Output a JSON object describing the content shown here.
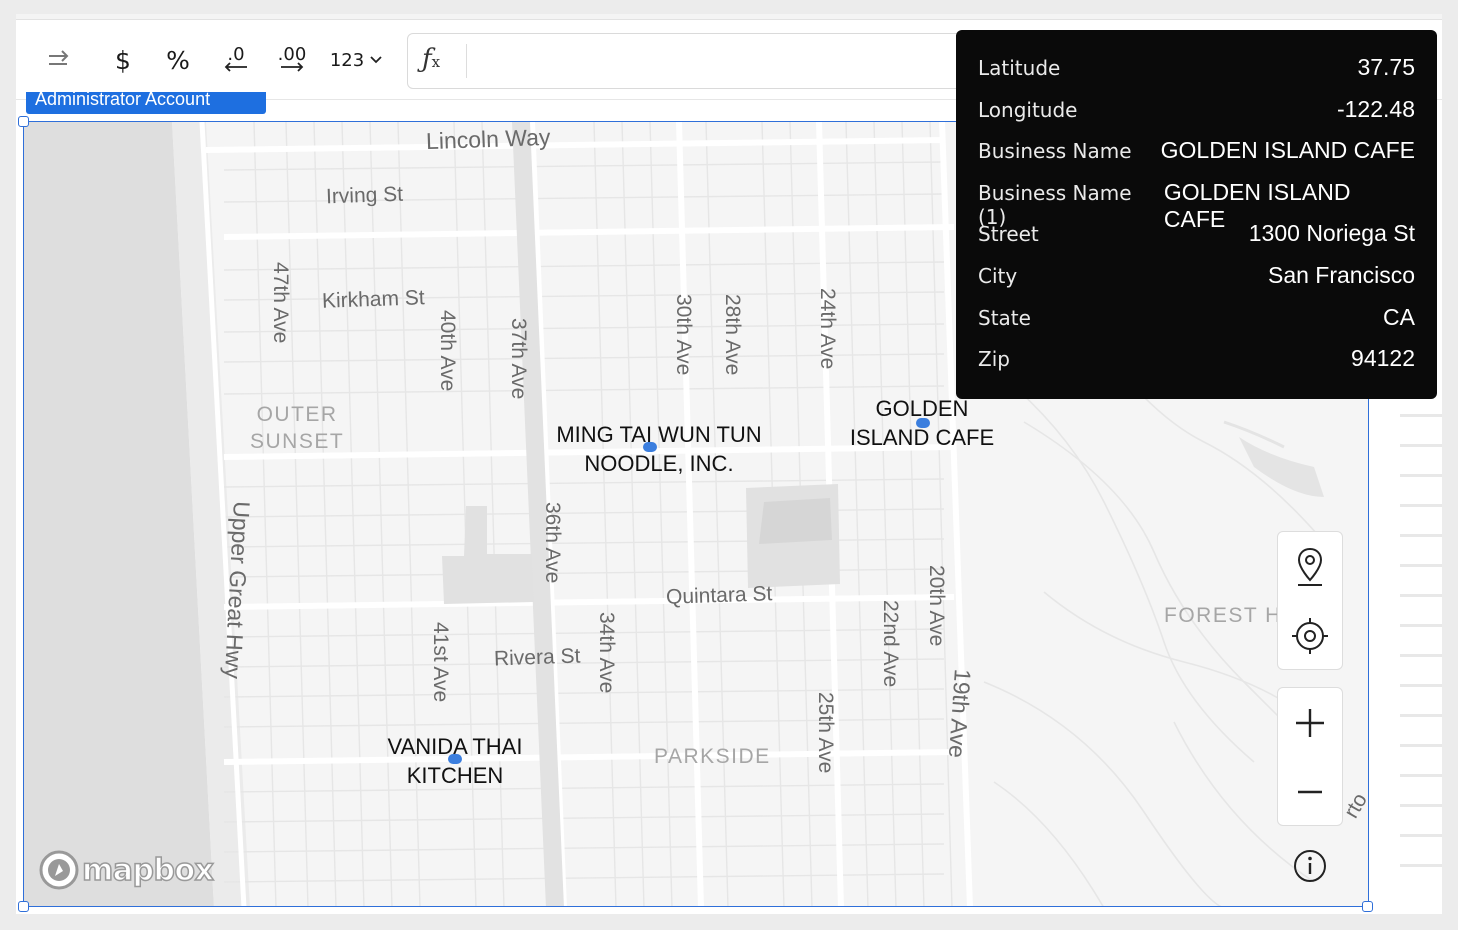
{
  "toolbar": {
    "currency_label": "$",
    "percent_label": "%",
    "decrease_decimals_label": ".0",
    "increase_decimals_label": ".00",
    "number_format_label": "123",
    "formula_placeholder": "",
    "formula_value": ""
  },
  "selection_badge": "Administrator Account",
  "tooltip": {
    "rows": [
      {
        "key": "Latitude",
        "value": "37.75"
      },
      {
        "key": "Longitude",
        "value": "-122.48"
      },
      {
        "key": "Business Name",
        "value": "GOLDEN ISLAND CAFE"
      },
      {
        "key": "Business Name (1)",
        "value": "GOLDEN ISLAND CAFE"
      },
      {
        "key": "Street",
        "value": "1300 Noriega St"
      },
      {
        "key": "City",
        "value": "San Francisco"
      },
      {
        "key": "State",
        "value": "CA"
      },
      {
        "key": "Zip",
        "value": "94122"
      }
    ]
  },
  "map": {
    "streets": {
      "lincoln": "Lincoln Way",
      "irving": "Irving St",
      "kirkham": "Kirkham St",
      "quintara": "Quintara St",
      "rivera": "Rivera St",
      "ave47": "47th Ave",
      "ave40": "40th Ave",
      "ave37": "37th Ave",
      "ave36": "36th Ave",
      "ave41": "41st Ave",
      "ave34": "34th Ave",
      "ave30": "30th Ave",
      "ave28": "28th Ave",
      "ave24": "24th Ave",
      "ave25": "25th Ave",
      "ave22": "22nd Ave",
      "ave20": "20th Ave",
      "ave19": "19th Ave",
      "great_hwy": "Upper Great Hwy",
      "partial_rt": "rto"
    },
    "neighborhoods": {
      "outer_sunset_1": "OUTER",
      "outer_sunset_2": "SUNSET",
      "parkside": "PARKSIDE",
      "forest_hill": "FOREST H"
    },
    "businesses": [
      {
        "line1": "MING TAI WUN TUN",
        "line2": "NOODLE, INC."
      },
      {
        "line1": "GOLDEN",
        "line2": "ISLAND CAFE"
      },
      {
        "line1": "VANIDA THAI",
        "line2": "KITCHEN"
      }
    ],
    "attribution": "mapbox",
    "marker_color": "#3b7ede"
  },
  "colors": {
    "selection_border": "#2f6fd9",
    "badge": "#1e6fe0",
    "tooltip_bg": "#0a0a0a"
  }
}
